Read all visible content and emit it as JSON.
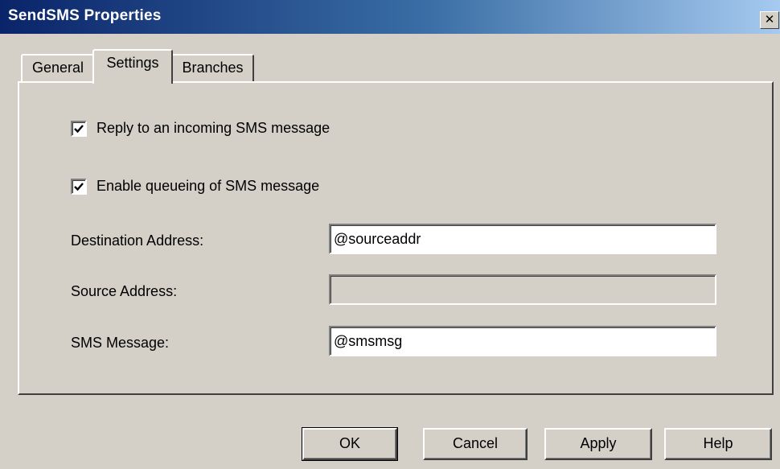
{
  "window": {
    "title": "SendSMS Properties",
    "close_glyph": "✕"
  },
  "tabs": [
    {
      "label": "General",
      "active": false
    },
    {
      "label": "Settings",
      "active": true
    },
    {
      "label": "Branches",
      "active": false
    }
  ],
  "settings": {
    "reply_checkbox": {
      "label": "Reply to an incoming SMS message",
      "checked": true
    },
    "queue_checkbox": {
      "label": "Enable queueing of SMS message",
      "checked": true
    },
    "destination": {
      "label": "Destination Address:",
      "value": "@sourceaddr",
      "enabled": true
    },
    "source": {
      "label": "Source Address:",
      "value": "",
      "enabled": false
    },
    "message": {
      "label": "SMS Message:",
      "value": "@smsmsg",
      "enabled": true
    }
  },
  "buttons": {
    "ok": "OK",
    "cancel": "Cancel",
    "apply": "Apply",
    "help": "Help"
  },
  "colors": {
    "title_gradient_start": "#0a246a",
    "title_gradient_end": "#a6caf0",
    "face": "#d4d0c8"
  }
}
